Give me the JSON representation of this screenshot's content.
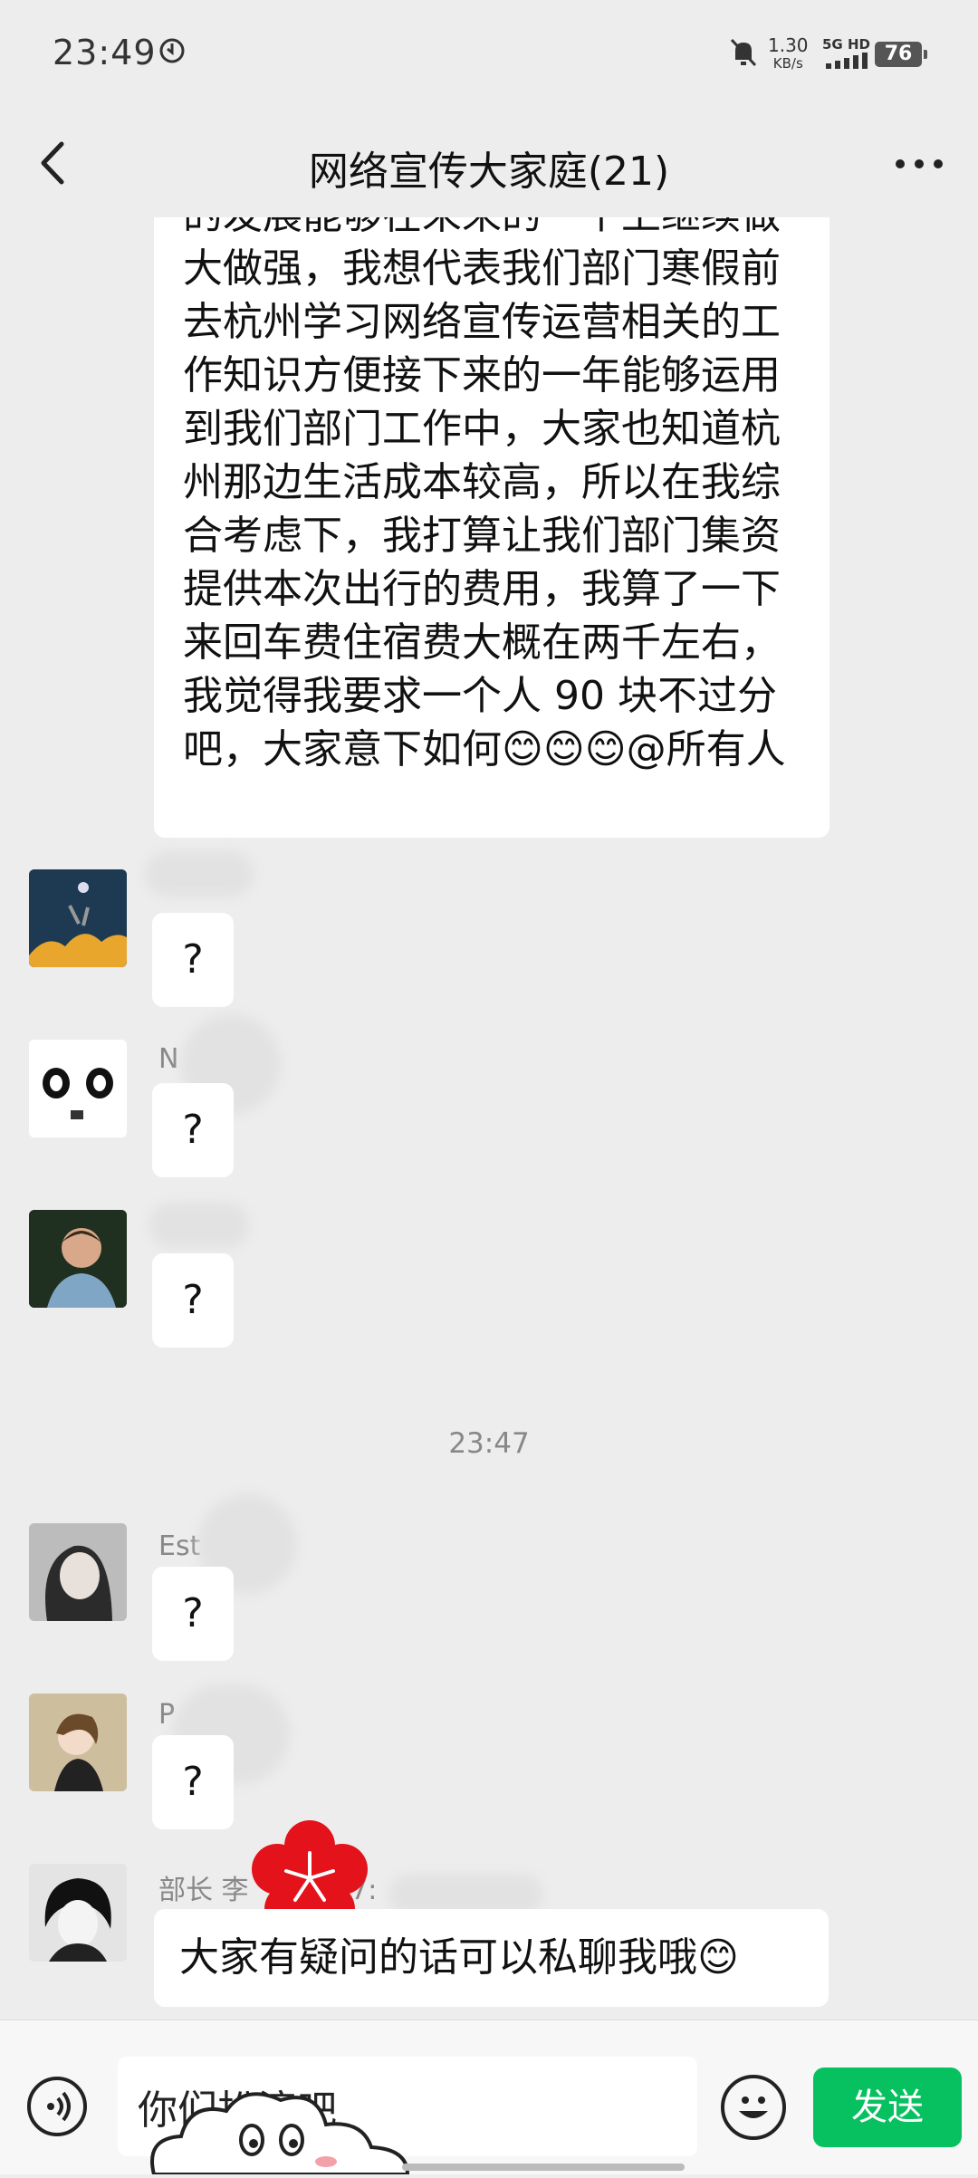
{
  "status_bar": {
    "time": "23:49",
    "net_speed_value": "1.30",
    "net_speed_unit": "KB/s",
    "signal_label": "5G HD",
    "battery": "76"
  },
  "header": {
    "title": "网络宣传大家庭(21)"
  },
  "messages": {
    "long_text": "的发展能够在未来的一个上继续做大做强，我想代表我们部门寒假前去杭州学习网络宣传运营相关的工作知识方便接下来的一年能够运用到我们部门工作中，大家也知道杭州那边生活成本较高，所以在我综合考虑下，我打算让我们部门集资提供本次出行的费用，我算了一下来回车费住宿费大概在两千左右，我觉得我要求一个人 90 块不过分吧，大家意下如何😊😊😊@所有人",
    "q1": "?",
    "name2": "N",
    "q2": "?",
    "q3": "?",
    "time_separator": "23:47",
    "name4": "Est",
    "q4": "?",
    "name5": "P",
    "q5": "?",
    "name6": "部长 李",
    "name6_suffix": "77:",
    "last_text": "大家有疑问的话可以私聊我哦😊"
  },
  "input": {
    "value": "你们扮演吧",
    "send_label": "发送"
  },
  "colors": {
    "accent": "#07c160",
    "background": "#ededed"
  }
}
